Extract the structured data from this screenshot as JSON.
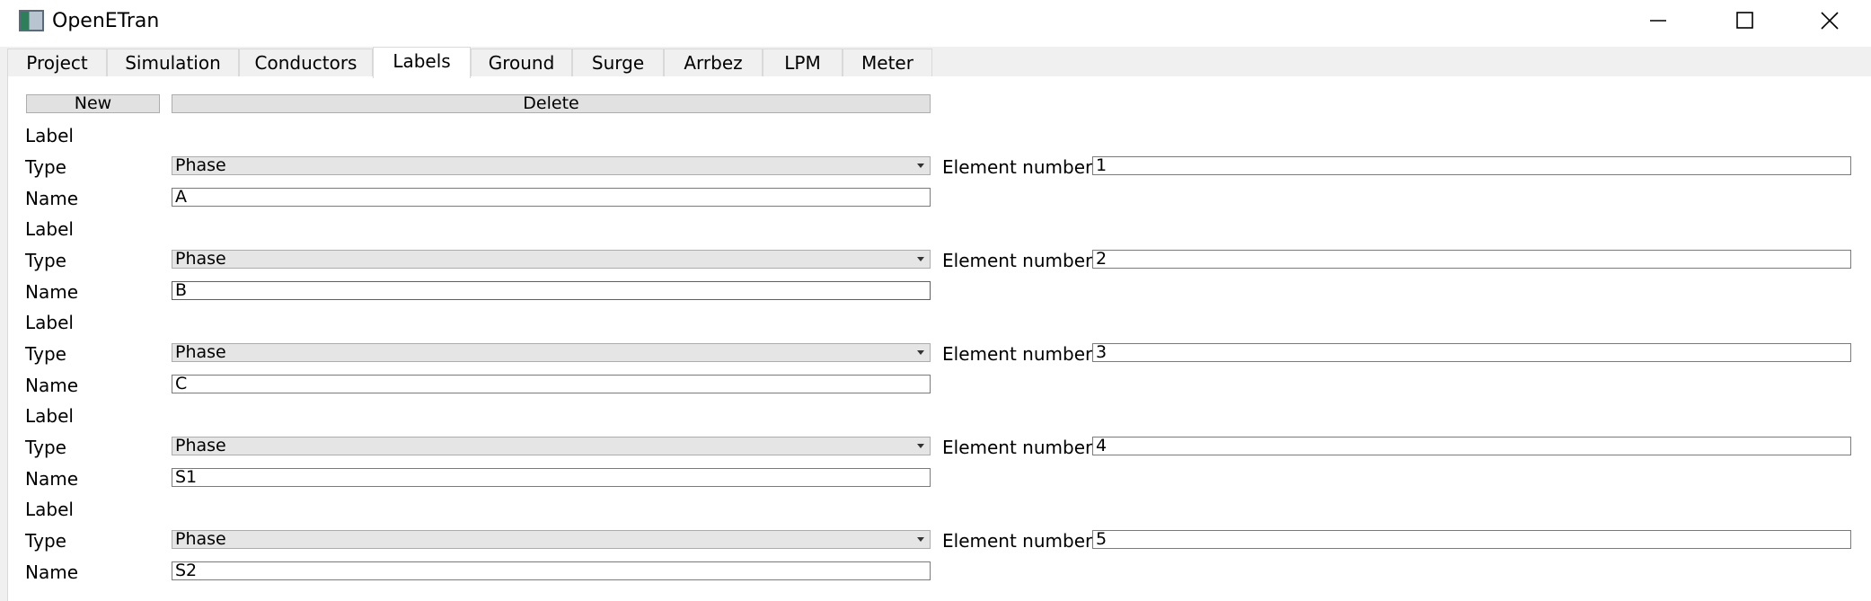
{
  "window": {
    "title": "OpenETran"
  },
  "tabs": [
    {
      "label": "Project"
    },
    {
      "label": "Simulation"
    },
    {
      "label": "Conductors"
    },
    {
      "label": "Labels"
    },
    {
      "label": "Ground"
    },
    {
      "label": "Surge"
    },
    {
      "label": "Arrbez"
    },
    {
      "label": "LPM"
    },
    {
      "label": "Meter"
    }
  ],
  "active_tab": "Labels",
  "toolbar": {
    "new_label": "New",
    "delete_label": "Delete"
  },
  "form": {
    "section_label": "Label",
    "type_label": "Type",
    "name_label": "Name",
    "element_number_label": "Element number"
  },
  "labels": [
    {
      "type": "Phase",
      "element_number": "1",
      "name": "A"
    },
    {
      "type": "Phase",
      "element_number": "2",
      "name": "B"
    },
    {
      "type": "Phase",
      "element_number": "3",
      "name": "C"
    },
    {
      "type": "Phase",
      "element_number": "4",
      "name": "S1"
    },
    {
      "type": "Phase",
      "element_number": "5",
      "name": "S2"
    }
  ],
  "focused_field": "labels.1.name",
  "colors": {
    "focus_border": "#0078d7",
    "window_bg": "#f0f0f0",
    "panel_bg": "#ffffff"
  },
  "icons": {
    "app": "openetran-app-icon",
    "minimize": "minimize-icon",
    "maximize": "maximize-icon",
    "close": "close-icon",
    "dropdown": "chevron-down-icon"
  }
}
